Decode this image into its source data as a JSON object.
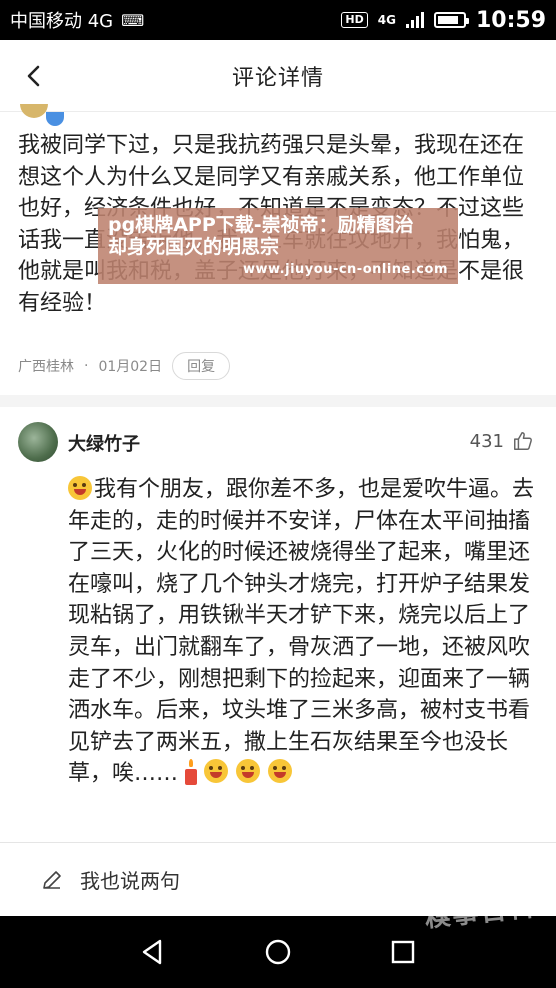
{
  "status_bar": {
    "carrier": "中国移动 4G",
    "network_badge": "HD",
    "network_type": "4G",
    "time": "10:59",
    "battery_level": 0.85
  },
  "header": {
    "title": "评论详情",
    "back_icon": "chevron-left-icon"
  },
  "first_comment": {
    "body": "我被同学下过，只是我抗药强只是头晕，我现在还在想这个人为什么又是同学又有亲戚关系，他工作单位也好，经济条件也好，不知道是不是变态？不过这些话我一直没告诉他，我一上车就往坟地开，我怕鬼，他就是叫我和税，盖子还是他打来，不知道是不是很有经验！",
    "location": "广西桂林",
    "date": "01月02日",
    "reply_label": "回复"
  },
  "second_comment": {
    "author": "大绿竹子",
    "likes": "431",
    "body": "我有个朋友，跟你差不多，也是爱吹牛逼。去年走的，走的时候并不安详，尸体在太平间抽搐了三天，火化的时候还被烧得坐了起来，嘴里还在嚎叫，烧了几个钟头才烧完，打开炉子结果发现粘锅了，用铁锹半天才铲下来，烧完以后上了灵车，出门就翻车了，骨灰洒了一地，还被风吹走了不少，刚想把剩下的捡起来，迎面来了一辆洒水车。后来，坟头堆了三米多高，被村支书看见铲去了两米五，撒上生石灰结果至今也没长草，唉……"
  },
  "watermark_banner": {
    "line1": "pg棋牌APP下载-崇祯帝：励精图治",
    "line2": "却身死国灭的明思宗",
    "url": "www.jiuyou-cn-online.com"
  },
  "bottom_bar": {
    "label": "我也说两句"
  },
  "corner_watermark": "糗事百科",
  "colors": {
    "statusbar_bg": "#000000",
    "watermark_bg": "#bd826e",
    "divider": "#f4f4f4",
    "text": "#222222",
    "meta": "#8a8a8a"
  }
}
